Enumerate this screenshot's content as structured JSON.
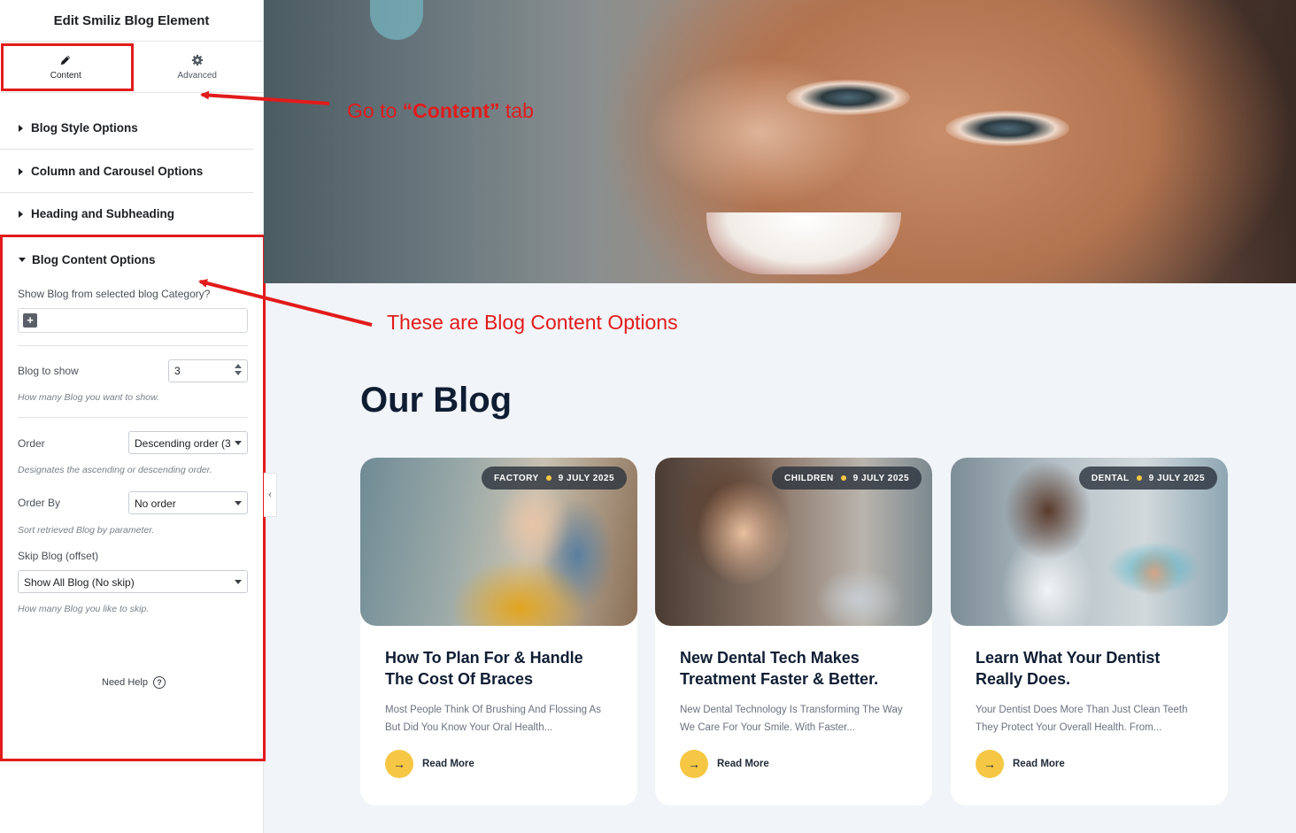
{
  "panel": {
    "title": "Edit Smiliz Blog Element",
    "tabs": {
      "content": "Content",
      "advanced": "Advanced"
    },
    "sections": {
      "blog_style": "Blog Style Options",
      "column_carousel": "Column and Carousel Options",
      "heading_subheading": "Heading and Subheading",
      "blog_content": "Blog Content Options"
    },
    "controls": {
      "category_label": "Show Blog from selected blog Category?",
      "category_add": "+",
      "blog_to_show_label": "Blog to show",
      "blog_to_show_value": "3",
      "blog_to_show_hint": "How many Blog you want to show.",
      "order_label": "Order",
      "order_value": "Descending order (3",
      "order_hint": "Designates the ascending or descending order.",
      "order_by_label": "Order By",
      "order_by_value": "No order",
      "order_by_hint": "Sort retrieved Blog by parameter.",
      "skip_label": "Skip Blog (offset)",
      "skip_value": "Show All Blog (No skip)",
      "skip_hint": "How many Blog you like to skip."
    },
    "need_help": "Need Help",
    "help_icon": "?"
  },
  "callouts": {
    "tab_prefix": "Go  to ",
    "tab_emphasis": "“Content”",
    "tab_suffix": " tab",
    "options": "These are Blog Content Options"
  },
  "blog": {
    "heading": "Our Blog",
    "read_more": "Read More",
    "posts": [
      {
        "category": "FACTORY",
        "date": "9 JULY 2025",
        "title": "How To Plan For & Handle The Cost Of Braces",
        "excerpt": "Most People Think Of Brushing And Flossing As But Did You Know Your Oral Health..."
      },
      {
        "category": "CHILDREN",
        "date": "9 JULY 2025",
        "title": "New Dental Tech Makes Treatment Faster & Better.",
        "excerpt": "New Dental Technology Is Transforming The Way We Care For Your Smile. With Faster..."
      },
      {
        "category": "DENTAL",
        "date": "9 JULY 2025",
        "title": "Learn What Your Dentist Really Does.",
        "excerpt": "Your Dentist Does More Than Just Clean Teeth They Protect Your Overall Health. From..."
      }
    ]
  },
  "colors": {
    "annotation_red": "#e21b1b",
    "accent_yellow": "#f6c744",
    "heading_navy": "#0f1d33",
    "preview_bg": "#f1f4f8"
  }
}
